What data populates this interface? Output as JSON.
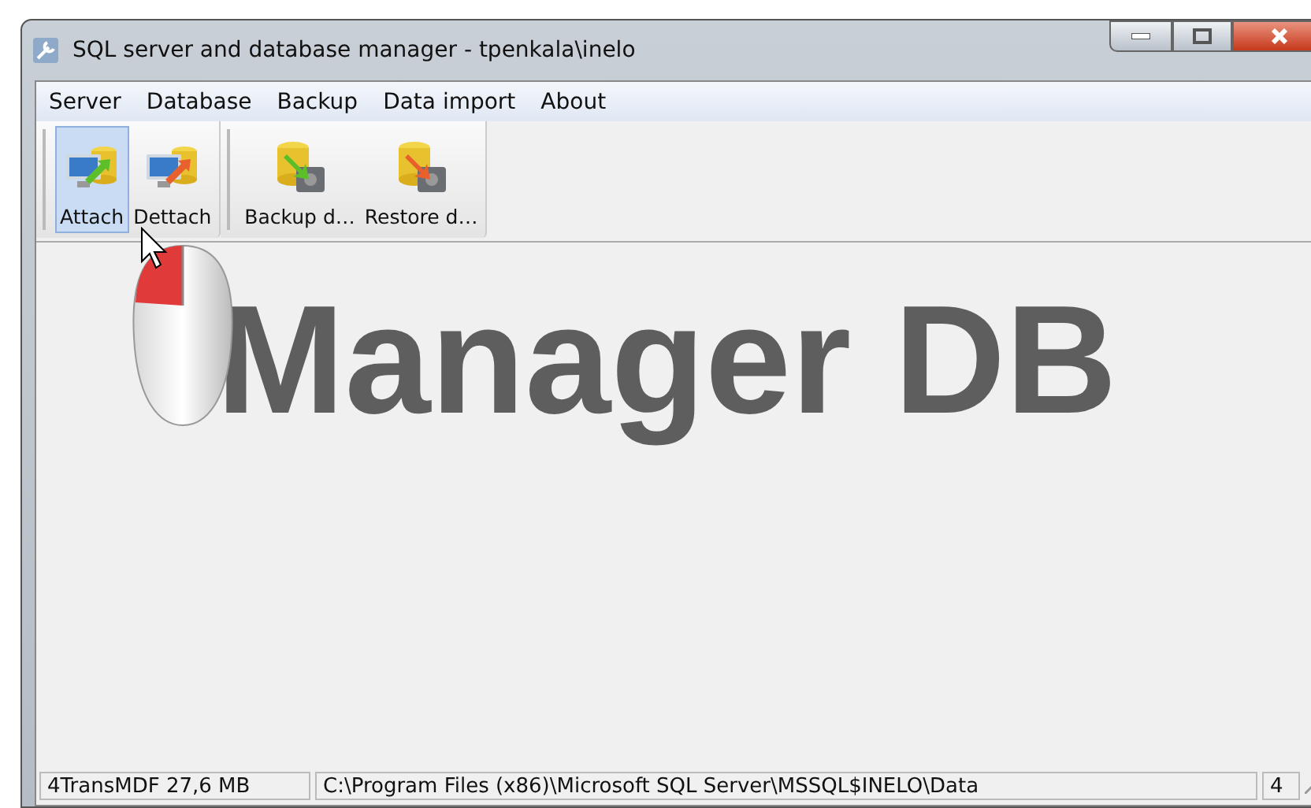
{
  "window": {
    "title": "SQL server and database manager - tpenkala\\inelo"
  },
  "menu": [
    {
      "label": "Server"
    },
    {
      "label": "Database"
    },
    {
      "label": "Backup"
    },
    {
      "label": "Data import"
    },
    {
      "label": "About"
    }
  ],
  "toolbar": {
    "groups": [
      [
        {
          "label": "Attach",
          "kind": "attach",
          "selected": true
        },
        {
          "label": "Dettach",
          "kind": "detach",
          "selected": false
        }
      ],
      [
        {
          "label": "Backup d…",
          "kind": "backup",
          "selected": false
        },
        {
          "label": "Restore d…",
          "kind": "restore",
          "selected": false
        }
      ]
    ]
  },
  "content": {
    "logo_text": "Manager DB"
  },
  "status_bar": [
    {
      "text": "4TransMDF  27,6 MB"
    },
    {
      "text": "C:\\Program Files (x86)\\Microsoft SQL Server\\MSSQL$INELO\\Data"
    },
    {
      "text": "4"
    }
  ]
}
